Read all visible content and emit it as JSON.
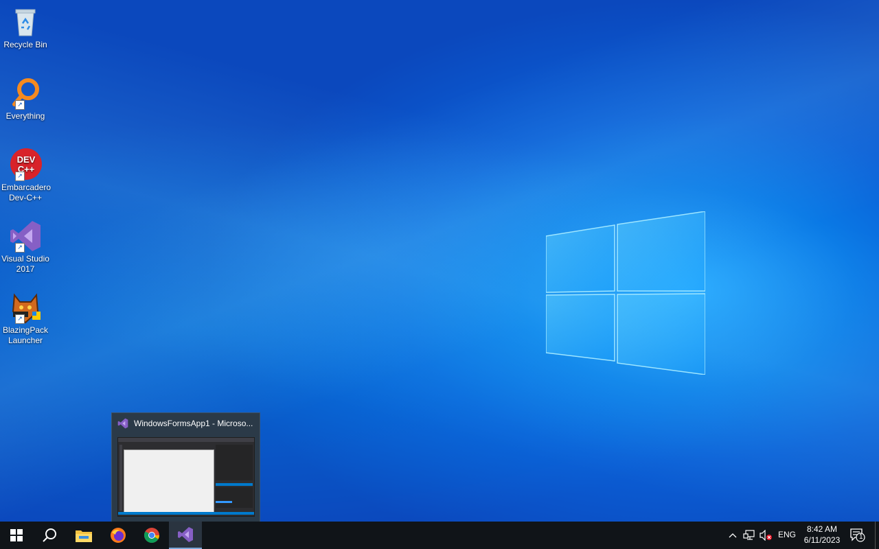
{
  "desktop": {
    "icons": [
      {
        "label": "Recycle Bin",
        "icon": "recycle-bin-icon"
      },
      {
        "label": "Everything",
        "icon": "everything-search-icon"
      },
      {
        "label": "Embarcadero Dev-C++",
        "icon": "devcpp-icon",
        "logo_text": "DEV C++"
      },
      {
        "label": "Visual Studio 2017",
        "icon": "visual-studio-icon"
      },
      {
        "label": "BlazingPack Launcher",
        "icon": "blazingpack-icon"
      }
    ]
  },
  "taskbar_preview": {
    "title": "WindowsFormsApp1 - Microso..."
  },
  "taskbar": {
    "apps": [
      {
        "name": "start",
        "icon": "windows-start-icon"
      },
      {
        "name": "search",
        "icon": "search-icon"
      },
      {
        "name": "file-explorer",
        "icon": "folder-icon"
      },
      {
        "name": "firefox",
        "icon": "firefox-icon"
      },
      {
        "name": "chrome",
        "icon": "chrome-icon"
      },
      {
        "name": "visual-studio",
        "icon": "visual-studio-icon",
        "active": true
      }
    ],
    "tray": {
      "language": "ENG",
      "time": "8:42 AM",
      "date": "6/11/2023",
      "notification_count": "1"
    }
  },
  "colors": {
    "taskbar": "#101418",
    "accent": "#0a7ae6",
    "vs_purple": "#865fc5"
  }
}
